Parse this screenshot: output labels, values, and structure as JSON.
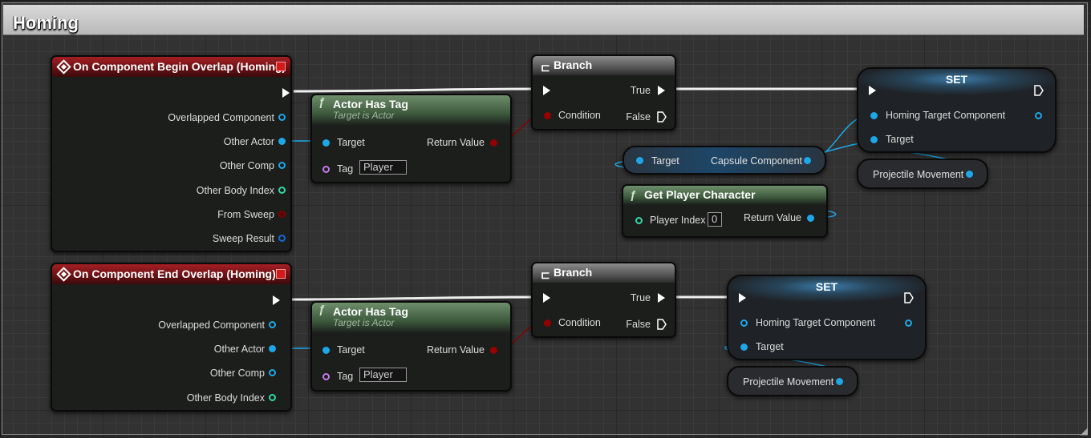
{
  "comment": {
    "title": "Homing"
  },
  "begin_overlap": {
    "title": "On Component Begin Overlap (Homing)",
    "pins": [
      "Overlapped Component",
      "Other Actor",
      "Other Comp",
      "Other Body Index",
      "From Sweep",
      "Sweep Result"
    ]
  },
  "end_overlap": {
    "title": "On Component End Overlap (Homing)",
    "pins": [
      "Overlapped Component",
      "Other Actor",
      "Other Comp",
      "Other Body Index"
    ]
  },
  "has_tag_1": {
    "title": "Actor Has Tag",
    "subtitle": "Target is Actor",
    "target": "Target",
    "tag": "Tag",
    "tag_value": "Player",
    "return": "Return Value"
  },
  "has_tag_2": {
    "title": "Actor Has Tag",
    "subtitle": "Target is Actor",
    "target": "Target",
    "tag": "Tag",
    "tag_value": "Player",
    "return": "Return Value"
  },
  "branch_1": {
    "title": "Branch",
    "condition": "Condition",
    "true": "True",
    "false": "False"
  },
  "branch_2": {
    "title": "Branch",
    "condition": "Condition",
    "true": "True",
    "false": "False"
  },
  "set_1": {
    "title": "SET",
    "pin": "Homing Target Component",
    "target": "Target"
  },
  "set_2": {
    "title": "SET",
    "pin": "Homing Target Component",
    "target": "Target"
  },
  "capsule": {
    "target": "Target",
    "output": "Capsule Component"
  },
  "get_player": {
    "title": "Get Player Character",
    "input": "Player Index",
    "input_value": "0",
    "return": "Return Value"
  },
  "projectile_1": {
    "label": "Projectile Movement"
  },
  "projectile_2": {
    "label": "Projectile Movement"
  },
  "colors": {
    "object_pin": "#1ea7e8",
    "bool_pin": "#950000",
    "int_pin": "#33d8a8",
    "name_pin": "#c57be8",
    "event_header": "#a51f24",
    "function_header": "#6e8e6c"
  }
}
